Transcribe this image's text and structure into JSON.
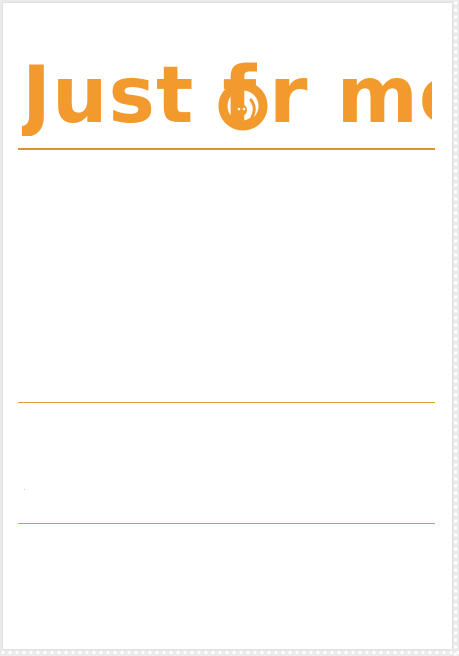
{
  "logo": {
    "text_part1": "Just f",
    "text_part2": "r  me",
    "color": "#f29a2e"
  },
  "colors": {
    "rule": "#e39c3a",
    "page": "#ffffff",
    "background": "#ebebeb"
  }
}
